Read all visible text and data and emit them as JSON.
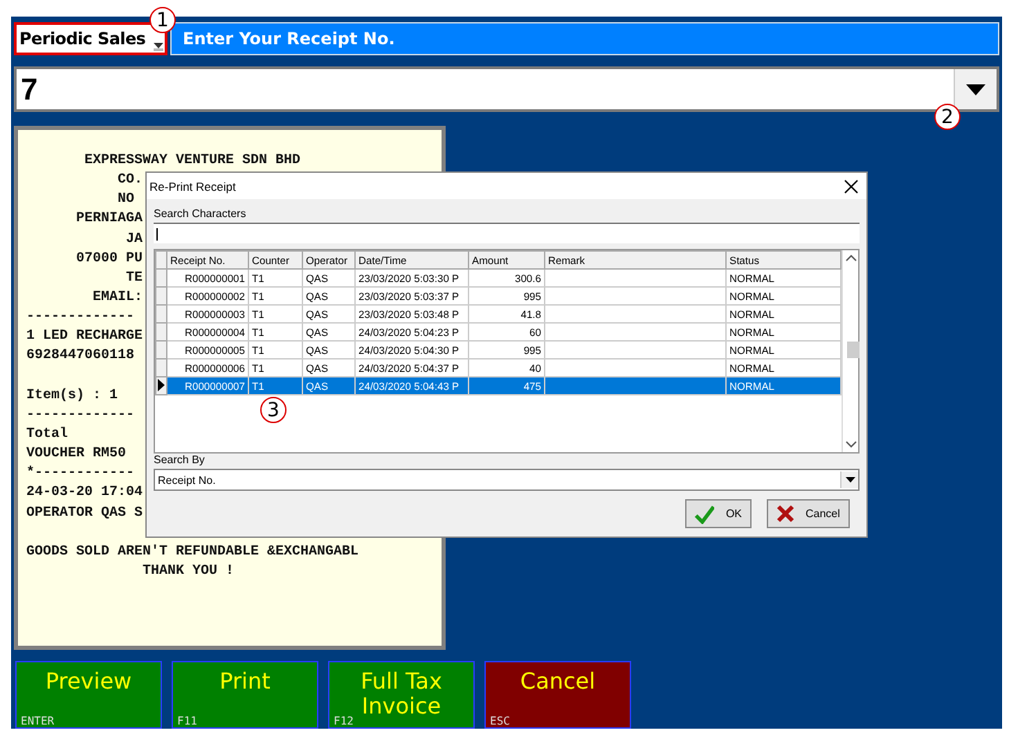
{
  "mode_select": {
    "value": "Periodic Sales"
  },
  "prompt_bar": {
    "text": "Enter Your Receipt No."
  },
  "receipt_field": {
    "value": "7"
  },
  "receipt_preview": {
    "lines": [
      {
        "kind": "text",
        "text": "       EXPRESSWAY VENTURE SDN BHD"
      },
      {
        "kind": "text",
        "text": "           CO."
      },
      {
        "kind": "text",
        "text": "           NO"
      },
      {
        "kind": "text",
        "text": "      PERNIAGA"
      },
      {
        "kind": "text",
        "text": "            JA"
      },
      {
        "kind": "text",
        "text": "      07000 PU"
      },
      {
        "kind": "text",
        "text": "            TE"
      },
      {
        "kind": "text",
        "text": "        EMAIL:"
      },
      {
        "kind": "text",
        "text": "-------------"
      },
      {
        "kind": "text",
        "text": "1 LED RECHARGE"
      },
      {
        "kind": "text",
        "text": "6928447060118"
      },
      {
        "kind": "blank"
      },
      {
        "kind": "text",
        "text": "Item(s) : 1"
      },
      {
        "kind": "text",
        "text": "-------------"
      },
      {
        "kind": "text",
        "text": "Total"
      },
      {
        "kind": "text",
        "text": "VOUCHER RM50"
      },
      {
        "kind": "text",
        "text": "*------------"
      },
      {
        "kind": "text",
        "text": "24-03-20 17:04"
      },
      {
        "kind": "text",
        "text": "OPERATOR QAS S"
      },
      {
        "kind": "blank"
      },
      {
        "kind": "text",
        "text": "GOODS SOLD AREN'T REFUNDABLE &EXCHANGABL"
      },
      {
        "kind": "text",
        "text": "              THANK YOU !"
      }
    ]
  },
  "dialog": {
    "title": "Re-Print Receipt",
    "search_label": "Search Characters",
    "table": {
      "columns": [
        "Receipt No.",
        "Counter",
        "Operator",
        "Date/Time",
        "Amount",
        "Remark",
        "Status"
      ],
      "rows": [
        {
          "selected": false,
          "cells": [
            "R000000001",
            "T1",
            "QAS",
            "23/03/2020 5:03:30 P",
            "300.6",
            "",
            "NORMAL"
          ]
        },
        {
          "selected": false,
          "cells": [
            "R000000002",
            "T1",
            "QAS",
            "23/03/2020 5:03:37 P",
            "995",
            "",
            "NORMAL"
          ]
        },
        {
          "selected": false,
          "cells": [
            "R000000003",
            "T1",
            "QAS",
            "23/03/2020 5:03:48 P",
            "41.8",
            "",
            "NORMAL"
          ]
        },
        {
          "selected": false,
          "cells": [
            "R000000004",
            "T1",
            "QAS",
            "24/03/2020 5:04:23 P",
            "60",
            "",
            "NORMAL"
          ]
        },
        {
          "selected": false,
          "cells": [
            "R000000005",
            "T1",
            "QAS",
            "24/03/2020 5:04:30 P",
            "995",
            "",
            "NORMAL"
          ]
        },
        {
          "selected": false,
          "cells": [
            "R000000006",
            "T1",
            "QAS",
            "24/03/2020 5:04:37 P",
            "40",
            "",
            "NORMAL"
          ]
        },
        {
          "selected": true,
          "cells": [
            "R000000007",
            "T1",
            "QAS",
            "24/03/2020 5:04:43 P",
            "475",
            "",
            "NORMAL"
          ]
        }
      ]
    },
    "search_by_label": "Search By",
    "search_by_value": "Receipt No.",
    "buttons": [
      {
        "kind": "ok",
        "label": "OK"
      },
      {
        "kind": "cancel",
        "label": "Cancel"
      }
    ]
  },
  "actions": [
    {
      "kind": "go",
      "label": "Preview",
      "key": "ENTER"
    },
    {
      "kind": "go",
      "label": "Print",
      "key": "F11"
    },
    {
      "kind": "go",
      "label": "Full Tax Invoice",
      "key": "F12"
    },
    {
      "kind": "stop",
      "label": "Cancel",
      "key": "ESC"
    }
  ],
  "callouts": [
    "1",
    "2",
    "3"
  ]
}
